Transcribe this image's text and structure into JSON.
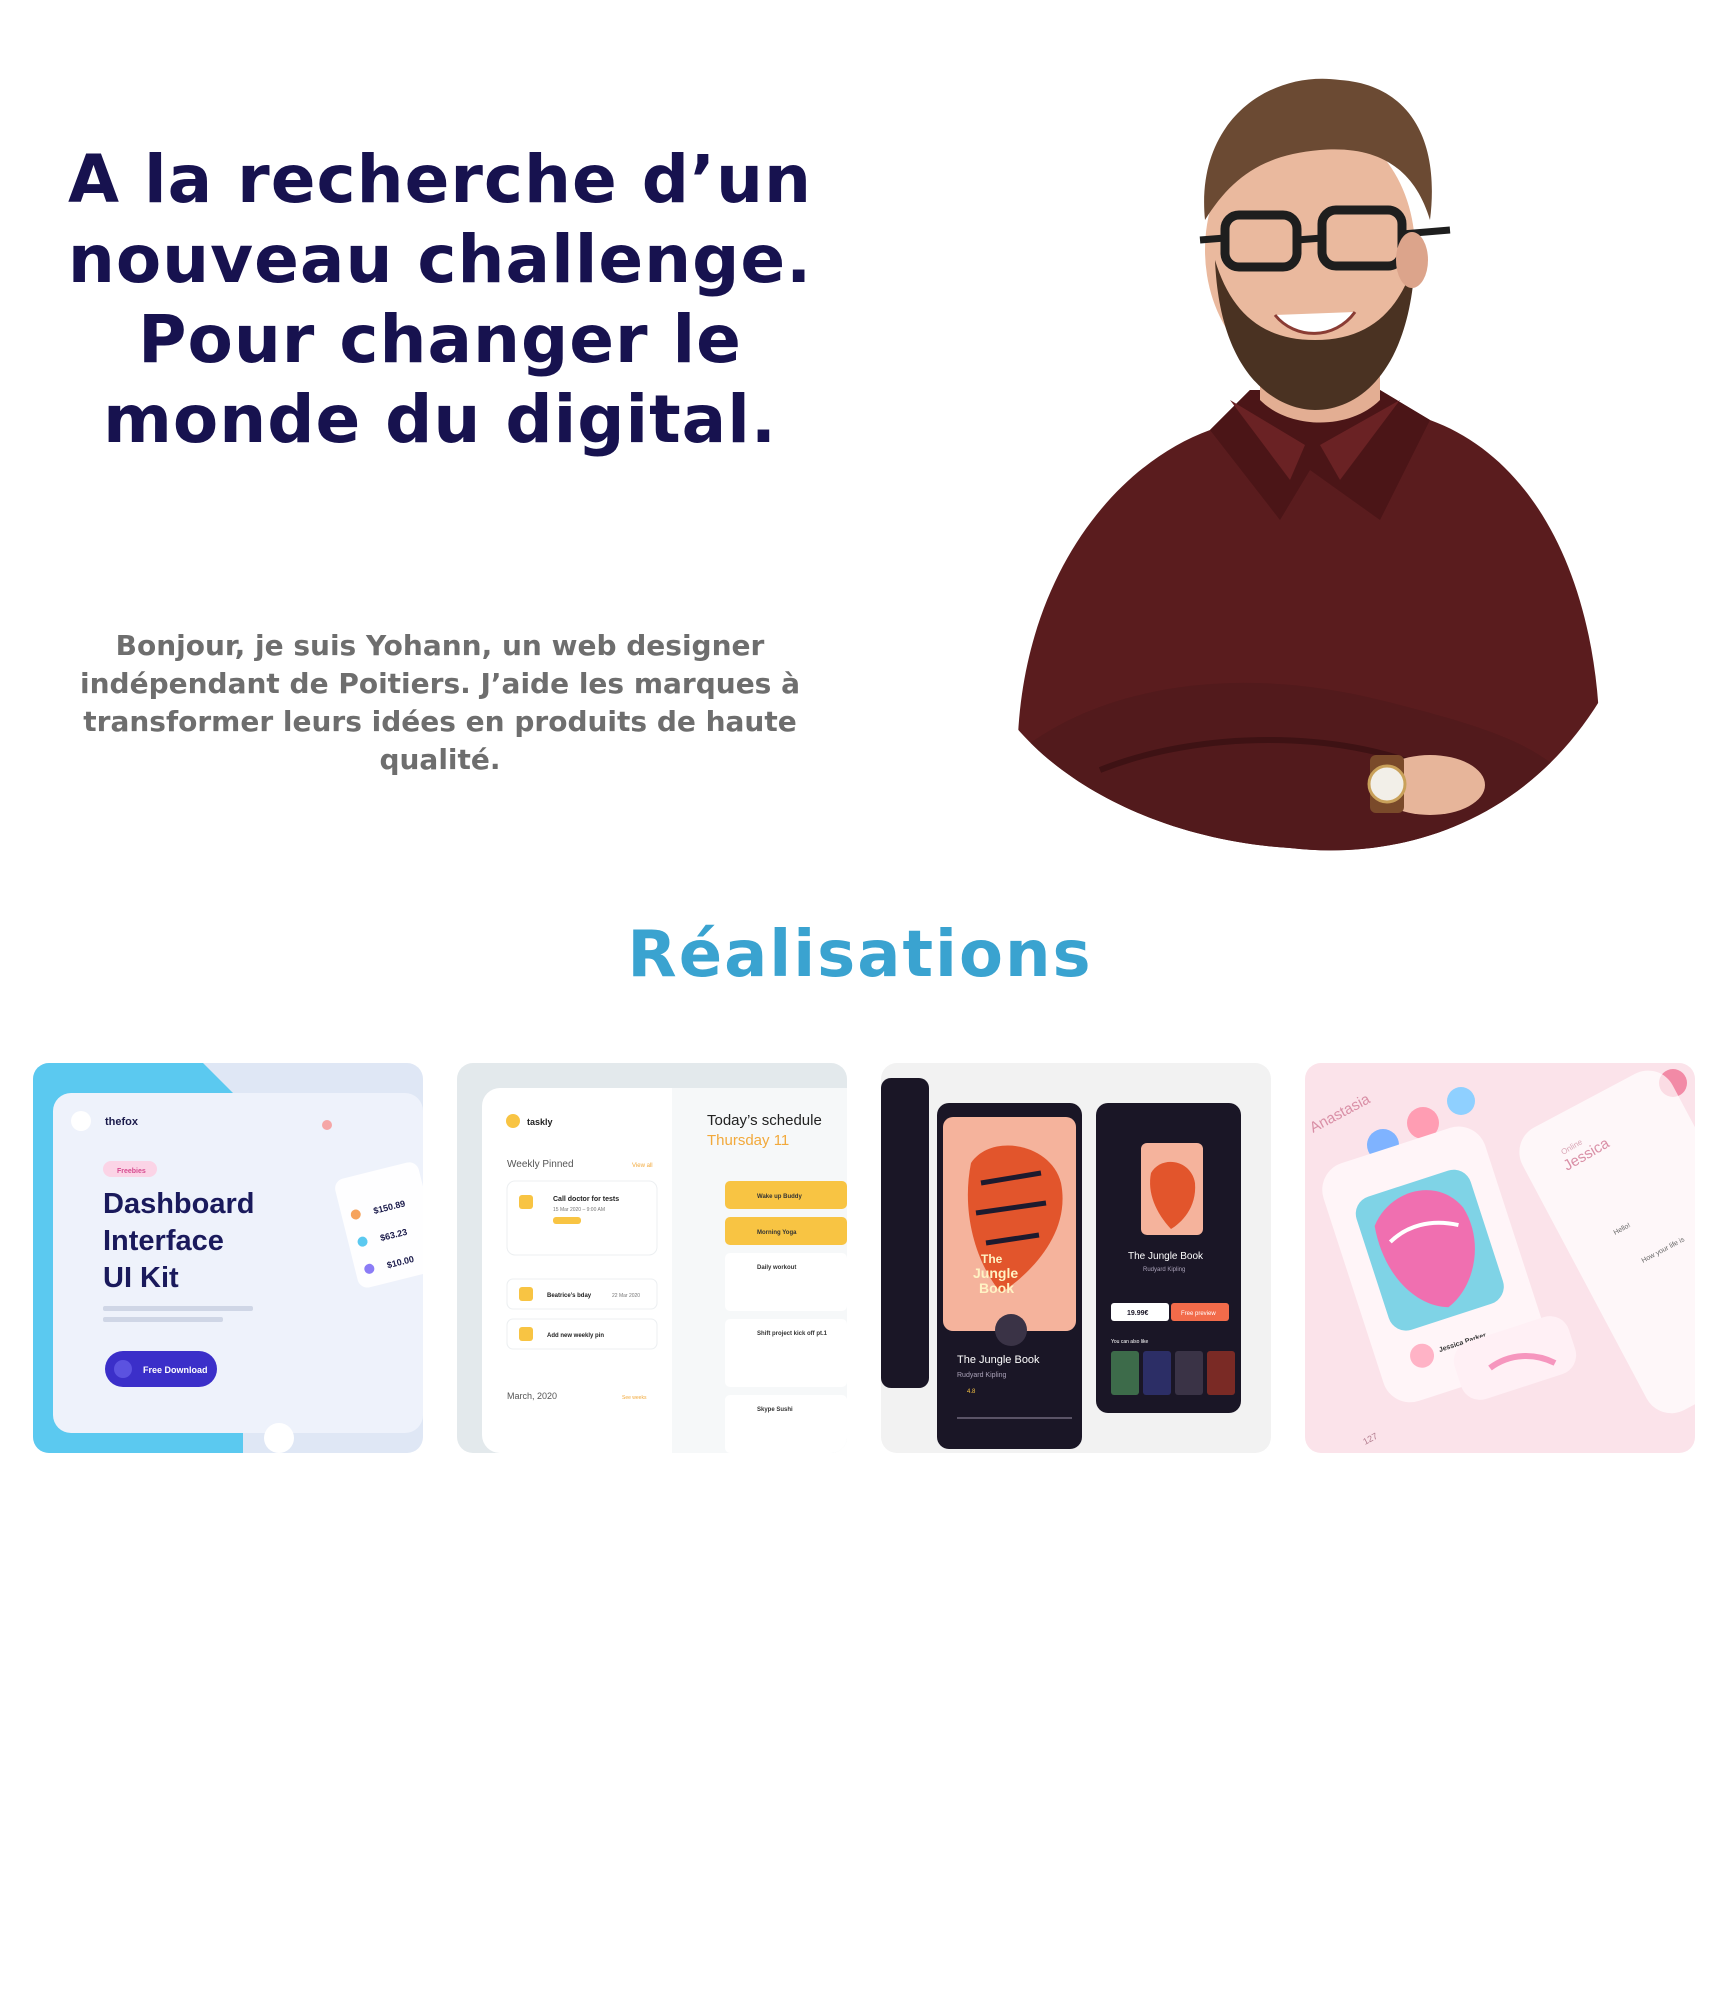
{
  "hero": {
    "title": "A la recherche d’un nouveau challenge. Pour changer le monde du digital.",
    "intro": "Bonjour, je suis Yohann, un web designer indépendant de Poitiers. J’aide les marques à transformer leurs idées en produits de haute qualité."
  },
  "portfolio": {
    "heading": "Réalisations",
    "items": [
      {
        "brand": "thefox",
        "tag": "Freebies",
        "title_line1": "Dashboard",
        "title_line2": "Interface",
        "title_line3": "UI Kit",
        "button": "Free Download",
        "amount1": "$150.89",
        "amount2": "$63.23",
        "amount3": "$10.00"
      },
      {
        "brand": "taskly",
        "schedule_title": "Today’s schedule",
        "schedule_date": "Thursday 11",
        "pinned": "Weekly Pinned",
        "view_all": "View all",
        "task1": "Call doctor for tests",
        "task1_date": "15 Mar 2020 – 9:00 AM",
        "task2": "Beatrice’s bday",
        "task2_date": "22 Mar 2020",
        "task3": "Add new weekly pin",
        "month": "March, 2020",
        "see_weeks": "See weeks",
        "slot1": "Wake up Buddy",
        "slot2": "Morning Yoga",
        "slot3": "Daily workout",
        "slot4": "Shift project kick off pt.1",
        "slot5": "Skype Sushi"
      },
      {
        "book_title": "The Jungle Book",
        "book_author": "Rudyard Kipling",
        "price": "19.99€",
        "preview": "Free preview",
        "also_like": "You can also like",
        "cover_text1": "The",
        "cover_text2": "Jungle",
        "cover_text3": "Book",
        "rating": "4.8"
      },
      {
        "name1": "Anastasia",
        "name2": "Jessica",
        "online": "Online",
        "person": "Jessica Parker",
        "msg1": "Hello!",
        "msg2": "How your life is",
        "count": "127"
      }
    ]
  }
}
